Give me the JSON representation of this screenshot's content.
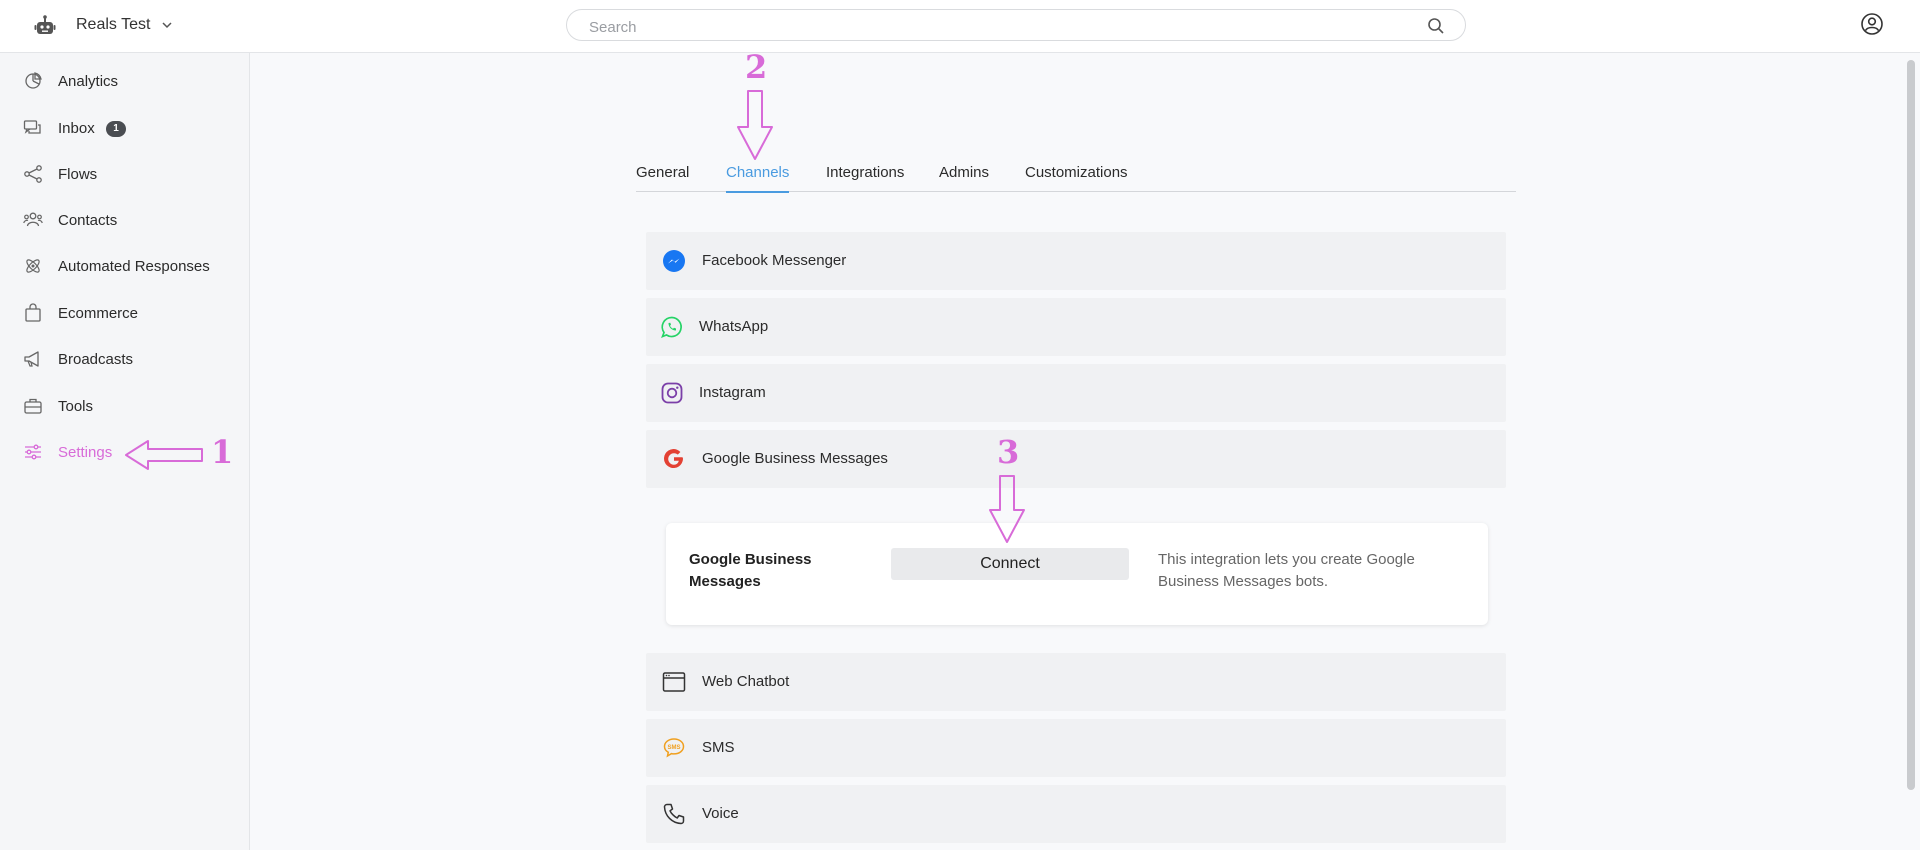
{
  "topbar": {
    "workspace_name": "Reals Test",
    "search_placeholder": "Search"
  },
  "sidebar": {
    "items": [
      {
        "label": "Analytics",
        "icon": "analytics-icon"
      },
      {
        "label": "Inbox",
        "icon": "inbox-icon",
        "badge": "1"
      },
      {
        "label": "Flows",
        "icon": "flows-icon"
      },
      {
        "label": "Contacts",
        "icon": "contacts-icon"
      },
      {
        "label": "Automated Responses",
        "icon": "automated-responses-icon"
      },
      {
        "label": "Ecommerce",
        "icon": "ecommerce-icon"
      },
      {
        "label": "Broadcasts",
        "icon": "broadcasts-icon"
      },
      {
        "label": "Tools",
        "icon": "tools-icon"
      },
      {
        "label": "Settings",
        "icon": "settings-icon",
        "active": true
      }
    ]
  },
  "tabs": [
    {
      "label": "General"
    },
    {
      "label": "Channels",
      "active": true
    },
    {
      "label": "Integrations"
    },
    {
      "label": "Admins"
    },
    {
      "label": "Customizations"
    }
  ],
  "channels": [
    {
      "label": "Facebook Messenger",
      "icon": "messenger-icon"
    },
    {
      "label": "WhatsApp",
      "icon": "whatsapp-icon"
    },
    {
      "label": "Instagram",
      "icon": "instagram-icon"
    },
    {
      "label": "Google Business Messages",
      "icon": "google-icon"
    },
    {
      "label": "Web Chatbot",
      "icon": "web-chatbot-icon"
    },
    {
      "label": "SMS",
      "icon": "sms-icon"
    },
    {
      "label": "Voice",
      "icon": "phone-icon"
    }
  ],
  "connect_card": {
    "title": "Google Business Messages",
    "button_label": "Connect",
    "description": "This integration lets you create Google Business Messages bots."
  },
  "annotations": {
    "one": "1",
    "two": "2",
    "three": "3"
  },
  "colors": {
    "accent_pink": "#d86bd8",
    "active_tab_blue": "#4a9be0"
  }
}
